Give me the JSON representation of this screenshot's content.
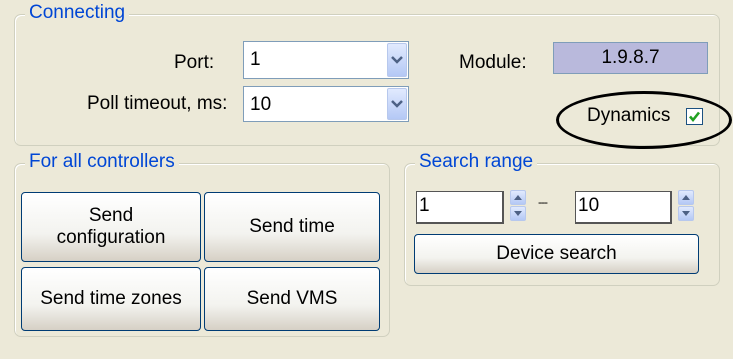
{
  "connecting": {
    "legend": "Connecting",
    "port_label": "Port:",
    "port_value": "1",
    "poll_label": "Poll timeout, ms:",
    "poll_value": "10",
    "module_label": "Module:",
    "module_value": "1.9.8.7",
    "dynamics_label": "Dynamics",
    "dynamics_checked": true
  },
  "controllers": {
    "legend": "For all controllers",
    "send_configuration": "Send configuration",
    "send_time": "Send time",
    "send_time_zones": "Send time zones",
    "send_vms": "Send VMS"
  },
  "search": {
    "legend": "Search range",
    "from_value": "1",
    "separator": "---",
    "to_value": "10",
    "device_search": "Device search"
  },
  "colors": {
    "legend_text": "#0046d5",
    "window_bg": "#ece9d8",
    "readonly_bg": "#b9b9dc",
    "checkmark": "#21a121"
  },
  "icons": [
    "chevron-down-icon",
    "spin-up-icon",
    "spin-down-icon",
    "checkmark-icon"
  ]
}
